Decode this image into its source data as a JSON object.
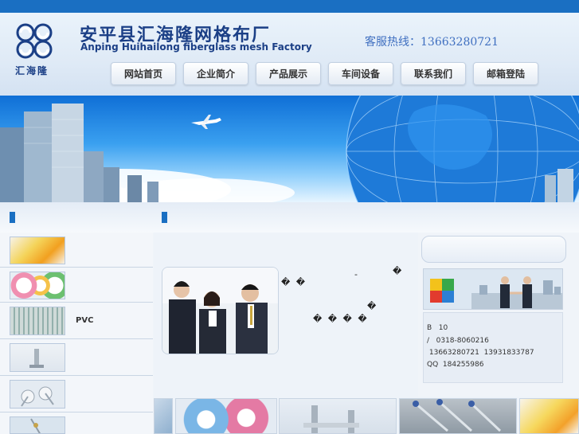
{
  "header": {
    "brand_cn": "安平县汇海隆网格布厂",
    "brand_en": "Anping Huihailong fiberglass mesh Factory",
    "logo_text": "汇海隆",
    "hotline": "客服热线：13663280721"
  },
  "nav": [
    {
      "label": "网站首页"
    },
    {
      "label": "企业简介"
    },
    {
      "label": "产品展示"
    },
    {
      "label": "车间设备"
    },
    {
      "label": "联系我们"
    },
    {
      "label": "邮箱登陆"
    }
  ],
  "sidebar": {
    "items": [
      {
        "label": ""
      },
      {
        "label": ""
      },
      {
        "label": "PVC"
      },
      {
        "label": ""
      },
      {
        "label": ""
      },
      {
        "label": ""
      }
    ]
  },
  "center": {
    "garble_1": "-",
    "garble_2": "�",
    "garble_3": "� �",
    "garble_4": "�",
    "garble_5": "� � � �"
  },
  "contact": {
    "line1": "B   10",
    "line2": "/   0318-8060216",
    "line3": " 13663280721  13931833787",
    "line4": "QQ  184255986"
  },
  "colors": {
    "brand_blue": "#1b3f86",
    "topbar": "#1a6fc2",
    "hotline": "#3f6fc0"
  },
  "icons": {
    "logo": "interlocking-swirls-logo",
    "banner_plane": "airplane-icon"
  }
}
